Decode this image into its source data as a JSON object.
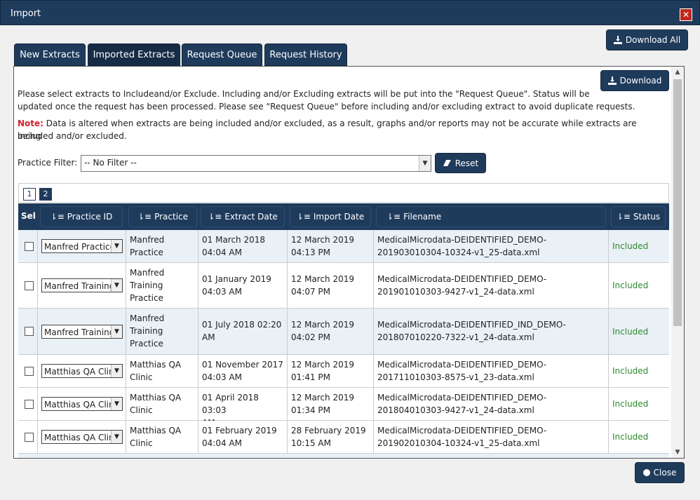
{
  "window": {
    "title": "Import",
    "close_icon": "close-icon"
  },
  "toolbar": {
    "download_all_label": "Download All"
  },
  "tabs": [
    {
      "label": "New Extracts"
    },
    {
      "label": "Imported Extracts"
    },
    {
      "label": "Request Queue"
    },
    {
      "label": "Request History"
    }
  ],
  "panel": {
    "download_label": "Download",
    "intro_line1": "Please select extracts to Includeand/or Exclude. Including and/or Excluding extracts will be put into the \"Request Queue\". Status will be",
    "intro_line2": "updated once the request has been processed. Please see \"Request Queue\" before including and/or excluding extract to avoid duplicate requests.",
    "note_label": "Note:",
    "note_line1": " Data is altered when extracts are being included and/or excluded, as a result, graphs and/or reports may not be accurate while extracts are being",
    "note_line2": "included and/or excluded.",
    "filter_label": "Practice Filter:",
    "filter_value": "-- No Filter --",
    "reset_label": "Reset"
  },
  "pagination": {
    "pages": [
      "1",
      "2"
    ],
    "current": "2"
  },
  "table": {
    "headers": {
      "sel": "Sel",
      "practice_id": "Practice ID",
      "practice": "Practice",
      "extract_date": "Extract Date",
      "import_date": "Import Date",
      "filename": "Filename",
      "status": "Status"
    },
    "rows": [
      {
        "practice_id": "Manfred Practice",
        "practice": [
          "Manfred",
          "Practice"
        ],
        "extract_date": [
          "01 March 2018",
          "04:04 AM"
        ],
        "import_date": [
          "12 March 2019",
          "04:13 PM"
        ],
        "filename": [
          "MedicalMicrodata-DEIDENTIFIED_DEMO-",
          "201903010304-10324-v1_25-data.xml"
        ],
        "status": "Included"
      },
      {
        "practice_id": "Manfred Training",
        "practice": [
          "Manfred",
          "Training",
          "Practice"
        ],
        "extract_date": [
          "01 January 2019",
          "04:03 AM"
        ],
        "import_date": [
          "12 March 2019",
          "04:07 PM"
        ],
        "filename": [
          "MedicalMicrodata-DEIDENTIFIED_DEMO-",
          "201901010303-9427-v1_24-data.xml"
        ],
        "status": "Included"
      },
      {
        "practice_id": "Manfred Training",
        "practice": [
          "Manfred",
          "Training",
          "Practice"
        ],
        "extract_date": [
          "01 July 2018 02:20",
          "AM"
        ],
        "import_date": [
          "12 March 2019",
          "04:02 PM"
        ],
        "filename": [
          "MedicalMicrodata-DEIDENTIFIED_IND_DEMO-",
          "201807010220-7322-v1_24-data.xml"
        ],
        "status": "Included"
      },
      {
        "practice_id": "Matthias QA Clinic",
        "practice": [
          "Matthias QA",
          "Clinic"
        ],
        "extract_date": [
          "01 November 2017",
          "04:03 AM"
        ],
        "import_date": [
          "12 March 2019",
          "01:41 PM"
        ],
        "filename": [
          "MedicalMicrodata-DEIDENTIFIED_DEMO-",
          "201711010303-8575-v1_23-data.xml"
        ],
        "status": "Included"
      },
      {
        "practice_id": "Matthias QA Clinic",
        "practice": [
          "Matthias QA",
          "Clinic"
        ],
        "extract_date": [
          "01 April 2018 03:03",
          "AM"
        ],
        "import_date": [
          "12 March 2019",
          "01:34 PM"
        ],
        "filename": [
          "MedicalMicrodata-DEIDENTIFIED_DEMO-",
          "201804010303-9427-v1_24-data.xml"
        ],
        "status": "Included"
      },
      {
        "practice_id": "Matthias QA Clinic",
        "practice": [
          "Matthias QA",
          "Clinic"
        ],
        "extract_date": [
          "01 February 2019",
          "04:04 AM"
        ],
        "import_date": [
          "28 February 2019",
          "10:15 AM"
        ],
        "filename": [
          "MedicalMicrodata-DEIDENTIFIED_DEMO-",
          "201902010304-10324-v1_25-data.xml"
        ],
        "status": "Included"
      }
    ]
  },
  "footer": {
    "close_label": "Close"
  },
  "colors": {
    "primary": "#1f3b5c",
    "alt_row": "#e9f0f6",
    "status_included": "#2e8b2e",
    "note": "#d0202a",
    "close_x": "#c0281e"
  }
}
